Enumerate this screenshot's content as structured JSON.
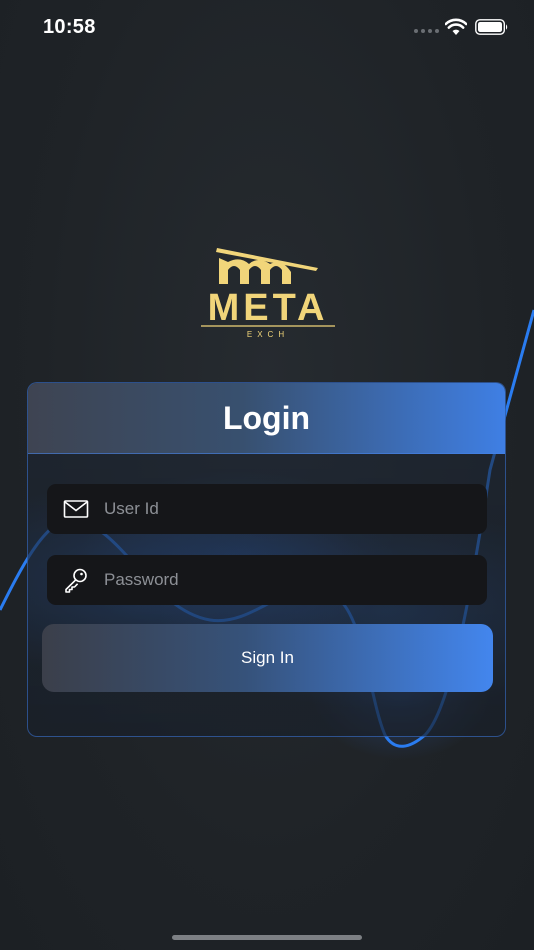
{
  "status_bar": {
    "time": "10:58"
  },
  "logo": {
    "brand": "META",
    "sub": "EXCH",
    "color": "#f1d57a"
  },
  "login": {
    "title": "Login",
    "user_id": {
      "value": "",
      "placeholder": "User Id",
      "icon": "envelope-icon"
    },
    "password": {
      "value": "",
      "placeholder": "Password",
      "icon": "key-icon"
    },
    "signin_label": "Sign In"
  },
  "colors": {
    "background": "#1f2327",
    "accent": "#4386ee",
    "field_bg": "#151619"
  }
}
